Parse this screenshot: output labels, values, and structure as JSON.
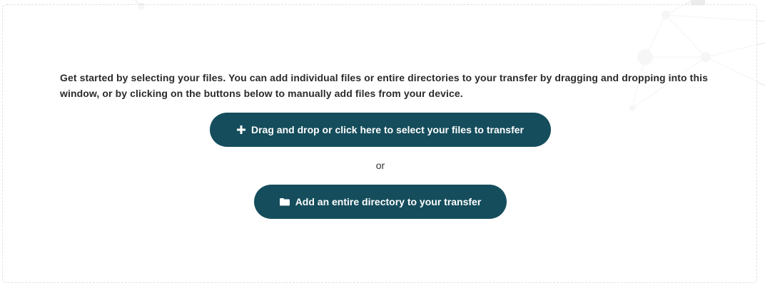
{
  "intro": {
    "text": "Get started by selecting your files. You can add individual files or entire directories to your transfer by dragging and dropping into this window, or by clicking on the buttons below to manually add files from your device."
  },
  "actions": {
    "select_files": {
      "icon": "plus-icon",
      "label": "Drag and drop or click here to select your files to transfer"
    },
    "separator": "or",
    "add_directory": {
      "icon": "folder-icon",
      "label": "Add an entire directory to your transfer"
    }
  },
  "colors": {
    "button_bg": "#154d5c",
    "button_text": "#ffffff",
    "text": "#2b2b2b",
    "dashed_border": "#e1e1e1"
  }
}
